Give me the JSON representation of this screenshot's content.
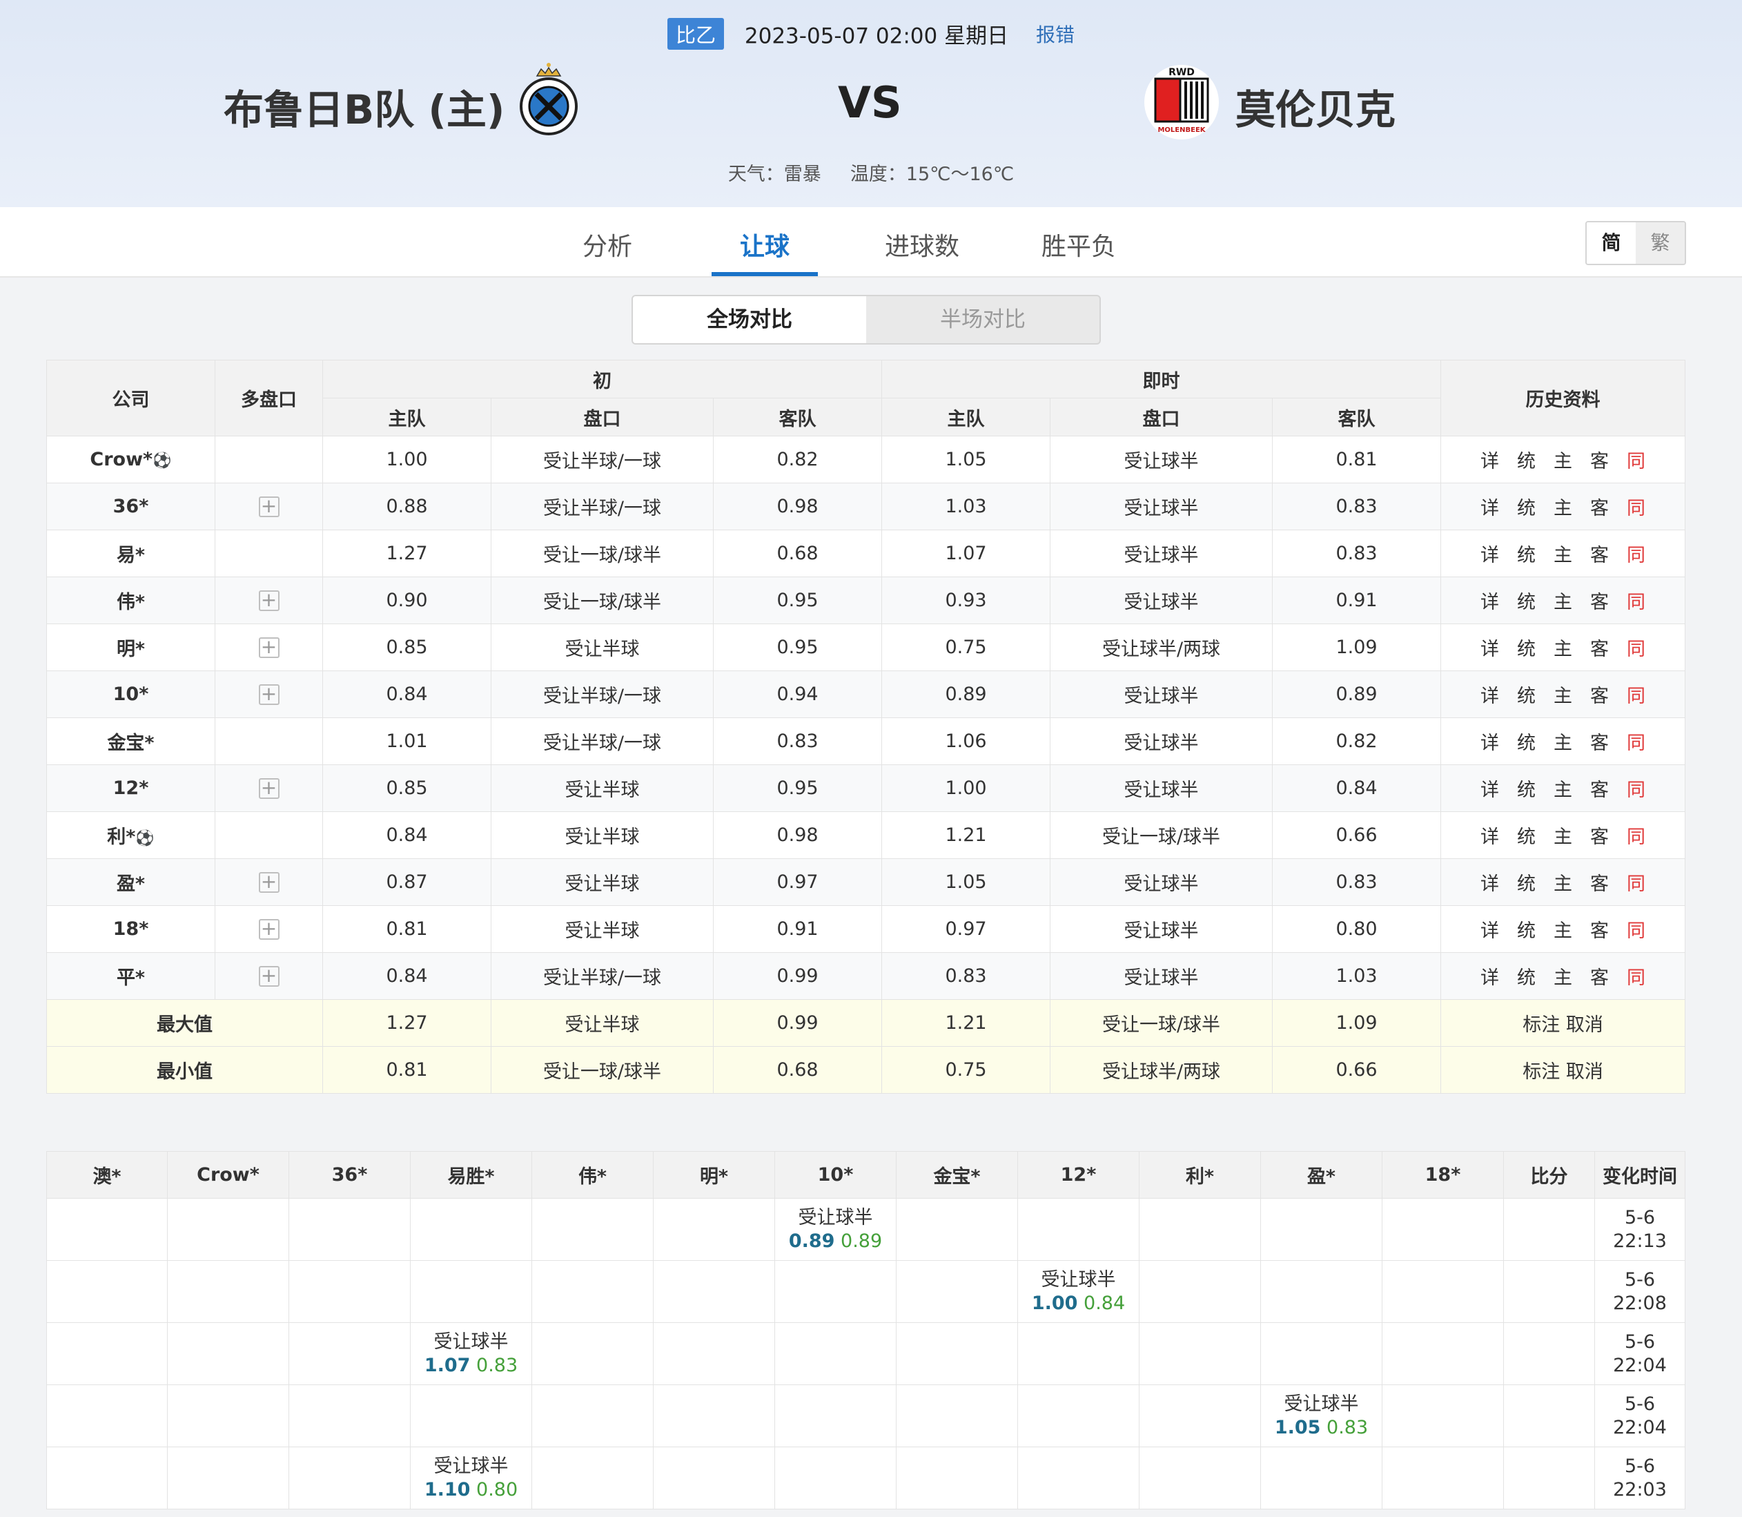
{
  "header": {
    "league": "比乙",
    "datetime": "2023-05-07 02:00 星期日",
    "report": "报错",
    "home_team": "布鲁日B队 (主)",
    "vs": "VS",
    "away_team": "莫伦贝克",
    "weather": "天气：雷暴",
    "temperature": "温度：15℃～16℃",
    "away_logo_text_top": "RWD",
    "away_logo_text_bottom": "MOLENBEEK"
  },
  "nav": {
    "tabs": [
      "分析",
      "让球",
      "进球数",
      "胜平负"
    ],
    "active": "让球",
    "lang_simplified": "简",
    "lang_traditional": "繁"
  },
  "segment": {
    "full": "全场对比",
    "half": "半场对比"
  },
  "table": {
    "headers": {
      "company": "公司",
      "multi": "多盘口",
      "initial": "初",
      "live": "即时",
      "history": "历史资料",
      "home": "主队",
      "line": "盘口",
      "away": "客队"
    },
    "history_links": [
      "详",
      "统",
      "主",
      "客",
      "同"
    ],
    "rows": [
      {
        "company": "Crow*",
        "ball": true,
        "plus": false,
        "i_home": "1.00",
        "i_line": "受让半球/一球",
        "i_away": "0.82",
        "l_home": "1.05",
        "l_line": "受让球半",
        "l_away": "0.81"
      },
      {
        "company": "36*",
        "ball": false,
        "plus": true,
        "i_home": "0.88",
        "i_line": "受让半球/一球",
        "i_away": "0.98",
        "l_home": "1.03",
        "l_line": "受让球半",
        "l_away": "0.83"
      },
      {
        "company": "易*",
        "ball": false,
        "plus": false,
        "i_home": "1.27",
        "i_line": "受让一球/球半",
        "i_away": "0.68",
        "l_home": "1.07",
        "l_line": "受让球半",
        "l_away": "0.83"
      },
      {
        "company": "伟*",
        "ball": false,
        "plus": true,
        "i_home": "0.90",
        "i_line": "受让一球/球半",
        "i_away": "0.95",
        "l_home": "0.93",
        "l_line": "受让球半",
        "l_away": "0.91"
      },
      {
        "company": "明*",
        "ball": false,
        "plus": true,
        "i_home": "0.85",
        "i_line": "受让半球",
        "i_away": "0.95",
        "l_home": "0.75",
        "l_line": "受让球半/两球",
        "l_away": "1.09"
      },
      {
        "company": "10*",
        "ball": false,
        "plus": true,
        "i_home": "0.84",
        "i_line": "受让半球/一球",
        "i_away": "0.94",
        "l_home": "0.89",
        "l_line": "受让球半",
        "l_away": "0.89"
      },
      {
        "company": "金宝*",
        "ball": false,
        "plus": false,
        "i_home": "1.01",
        "i_line": "受让半球/一球",
        "i_away": "0.83",
        "l_home": "1.06",
        "l_line": "受让球半",
        "l_away": "0.82"
      },
      {
        "company": "12*",
        "ball": false,
        "plus": true,
        "i_home": "0.85",
        "i_line": "受让半球",
        "i_away": "0.95",
        "l_home": "1.00",
        "l_line": "受让球半",
        "l_away": "0.84"
      },
      {
        "company": "利*",
        "ball": true,
        "plus": false,
        "i_home": "0.84",
        "i_line": "受让半球",
        "i_away": "0.98",
        "l_home": "1.21",
        "l_line": "受让一球/球半",
        "l_away": "0.66"
      },
      {
        "company": "盈*",
        "ball": false,
        "plus": true,
        "i_home": "0.87",
        "i_line": "受让半球",
        "i_away": "0.97",
        "l_home": "1.05",
        "l_line": "受让球半",
        "l_away": "0.83"
      },
      {
        "company": "18*",
        "ball": false,
        "plus": true,
        "i_home": "0.81",
        "i_line": "受让半球",
        "i_away": "0.91",
        "l_home": "0.97",
        "l_line": "受让球半",
        "l_away": "0.80"
      },
      {
        "company": "平*",
        "ball": false,
        "plus": true,
        "i_home": "0.84",
        "i_line": "受让半球/一球",
        "i_away": "0.99",
        "l_home": "0.83",
        "l_line": "受让球半",
        "l_away": "1.03"
      }
    ],
    "max": {
      "label": "最大值",
      "i_home": "1.27",
      "i_line": "受让半球",
      "i_away": "0.99",
      "l_home": "1.21",
      "l_line": "受让一球/球半",
      "l_away": "1.09",
      "action": "标注 取消"
    },
    "min": {
      "label": "最小值",
      "i_home": "0.81",
      "i_line": "受让一球/球半",
      "i_away": "0.68",
      "l_home": "0.75",
      "l_line": "受让球半/两球",
      "l_away": "0.66",
      "action": "标注 取消"
    }
  },
  "changes": {
    "headers": [
      "澳*",
      "Crow*",
      "36*",
      "易胜*",
      "伟*",
      "明*",
      "10*",
      "金宝*",
      "12*",
      "利*",
      "盈*",
      "18*",
      "比分",
      "变化时间"
    ],
    "rows": [
      {
        "col": 6,
        "line": "受让球半",
        "home": "0.89",
        "away": "0.89",
        "time": "5-6 22:13"
      },
      {
        "col": 8,
        "line": "受让球半",
        "home": "1.00",
        "away": "0.84",
        "time": "5-6 22:08"
      },
      {
        "col": 3,
        "line": "受让球半",
        "home": "1.07",
        "away": "0.83",
        "time": "5-6 22:04"
      },
      {
        "col": 10,
        "line": "受让球半",
        "home": "1.05",
        "away": "0.83",
        "time": "5-6 22:04"
      },
      {
        "col": 3,
        "line": "受让球半",
        "home": "1.10",
        "away": "0.80",
        "time": "5-6 22:03"
      }
    ]
  }
}
